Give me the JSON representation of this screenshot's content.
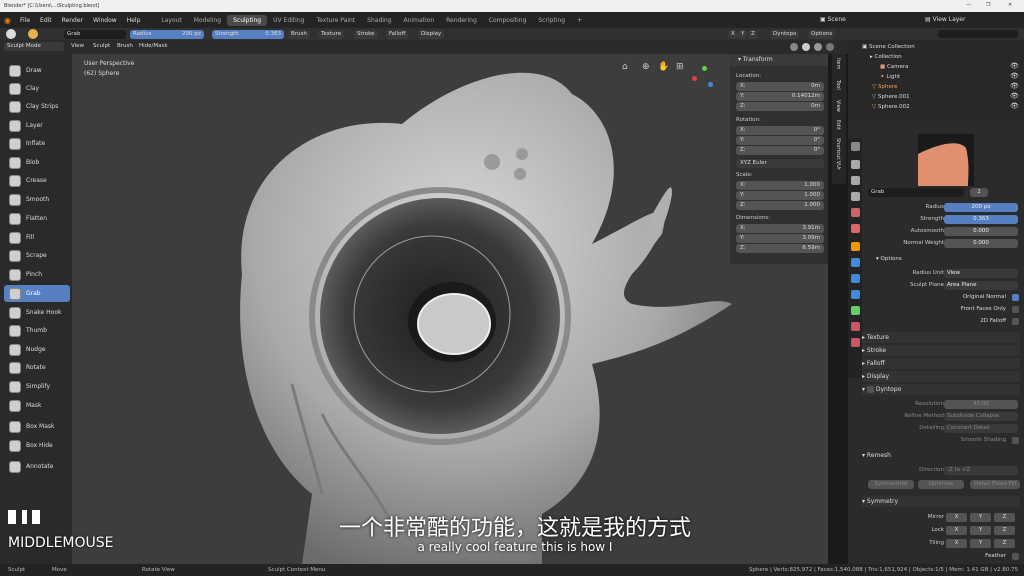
{
  "titlebar": {
    "title": "Blender* [C:\\Users\\...\\Sculpting.blend]",
    "min": "—",
    "max": "❐",
    "close": "✕"
  },
  "menu": {
    "items": [
      "File",
      "Edit",
      "Render",
      "Window",
      "Help"
    ],
    "workspaces": [
      "Layout",
      "Modeling",
      "Sculpting",
      "UV Editing",
      "Texture Paint",
      "Shading",
      "Animation",
      "Rendering",
      "Compositing",
      "Scripting"
    ],
    "active_workspace": "Sculpting",
    "add": "+",
    "scene": "Scene",
    "view_layer": "View Layer"
  },
  "header": {
    "brush_name": "Grab",
    "radius_label": "Radius",
    "radius_value": "200 px",
    "strength_label": "Strength",
    "strength_value": "0.363",
    "menus": [
      "Brush",
      "Texture",
      "Stroke",
      "Falloff",
      "Display"
    ],
    "axes": [
      "X",
      "Y",
      "Z"
    ],
    "dyntopo": "Dyntopo",
    "options": "Options"
  },
  "subheader": {
    "mode": "Sculpt Mode",
    "menus": [
      "View",
      "Sculpt",
      "Brush",
      "Hide/Mask"
    ]
  },
  "tools": [
    "Draw",
    "Clay",
    "Clay Strips",
    "Layer",
    "Inflate",
    "Blob",
    "Crease",
    "Smooth",
    "Flatten",
    "Fill",
    "Scrape",
    "Pinch",
    "Grab",
    "Snake Hook",
    "Thumb",
    "Nudge",
    "Rotate",
    "Simplify",
    "Mask",
    "Box Mask",
    "Box Hide",
    "Annotate"
  ],
  "active_tool": "Grab",
  "viewport": {
    "perspective": "User Perspective",
    "object": "(62) Sphere"
  },
  "npanel": {
    "title": "Transform",
    "location": "Location:",
    "loc": [
      {
        "axis": "X:",
        "value": "0m"
      },
      {
        "axis": "Y:",
        "value": "0.14012m"
      },
      {
        "axis": "Z:",
        "value": "0m"
      }
    ],
    "rotation": "Rotation:",
    "rot": [
      {
        "axis": "X:",
        "value": "0°"
      },
      {
        "axis": "Y:",
        "value": "0°"
      },
      {
        "axis": "Z:",
        "value": "0°"
      }
    ],
    "euler": "XYZ Euler",
    "scale": "Scale:",
    "scl": [
      {
        "axis": "X:",
        "value": "1.000"
      },
      {
        "axis": "Y:",
        "value": "1.000"
      },
      {
        "axis": "Z:",
        "value": "1.000"
      }
    ],
    "dimensions": "Dimensions:",
    "dim": [
      {
        "axis": "X:",
        "value": "3.91m"
      },
      {
        "axis": "Y:",
        "value": "3.09m"
      },
      {
        "axis": "Z:",
        "value": "6.59m"
      }
    ],
    "tabs": [
      "Item",
      "Tool",
      "View",
      "Edit",
      "Shortcut VUr"
    ]
  },
  "outliner": {
    "root": "Scene Collection",
    "items": [
      "Collection",
      "Camera",
      "Light",
      "Sphere",
      "Sphere.001",
      "Sphere.002"
    ]
  },
  "props": {
    "brush": "Grab",
    "users": "2",
    "radius_label": "Radius",
    "radius": "200 px",
    "strength_label": "Strength",
    "strength": "0.363",
    "autosmooth_label": "Autosmooth",
    "autosmooth": "0.000",
    "normal_weight_label": "Normal Weight",
    "normal_weight": "0.000",
    "options": "Options",
    "radius_unit_label": "Radius Unit",
    "radius_unit": "View",
    "sculpt_plane_label": "Sculpt Plane",
    "sculpt_plane": "Area Plane",
    "original_normal": "Original Normal",
    "front_faces": "Front Faces Only",
    "falloff_2d": "2D Falloff",
    "sections": [
      "Texture",
      "Stroke",
      "Falloff",
      "Display"
    ],
    "dyntopo": "Dyntopo",
    "resolution_label": "Resolution",
    "resolution": "45.00",
    "refine_label": "Refine Method",
    "refine": "Subdivide Collapse",
    "detailing_label": "Detailing",
    "detailing": "Constant Detail",
    "smooth_shading": "Smooth Shading",
    "remesh": "Remesh",
    "direction_label": "Direction",
    "direction": "-Z to +Z",
    "symmetrize": "Symmetrize",
    "optimize": "Optimize",
    "detail_flood": "Detail Flood Fill",
    "symmetry": "Symmetry",
    "mirror": "Mirror",
    "lock": "Lock",
    "tiling": "Tiling",
    "feather": "Feather"
  },
  "status": {
    "left": [
      "Sculpt",
      "Move",
      "Rotate View",
      "Sculpt Context Menu"
    ],
    "right": "Sphere | Verts:825,972 | Faces:1,540,088 | Tris:1,651,924 | Objects:1/5 | Mem: 1.41 GB | v2.80.75"
  },
  "overlay": {
    "key": "MIDDLEMOUSE",
    "subtitle_zh": "一个非常酷的功能，这就是我的方式",
    "subtitle_en": "a really cool feature this is how I"
  },
  "colors": {
    "accent": "#5680c2",
    "panel": "#303030",
    "viewport": "#3d3d3d"
  }
}
